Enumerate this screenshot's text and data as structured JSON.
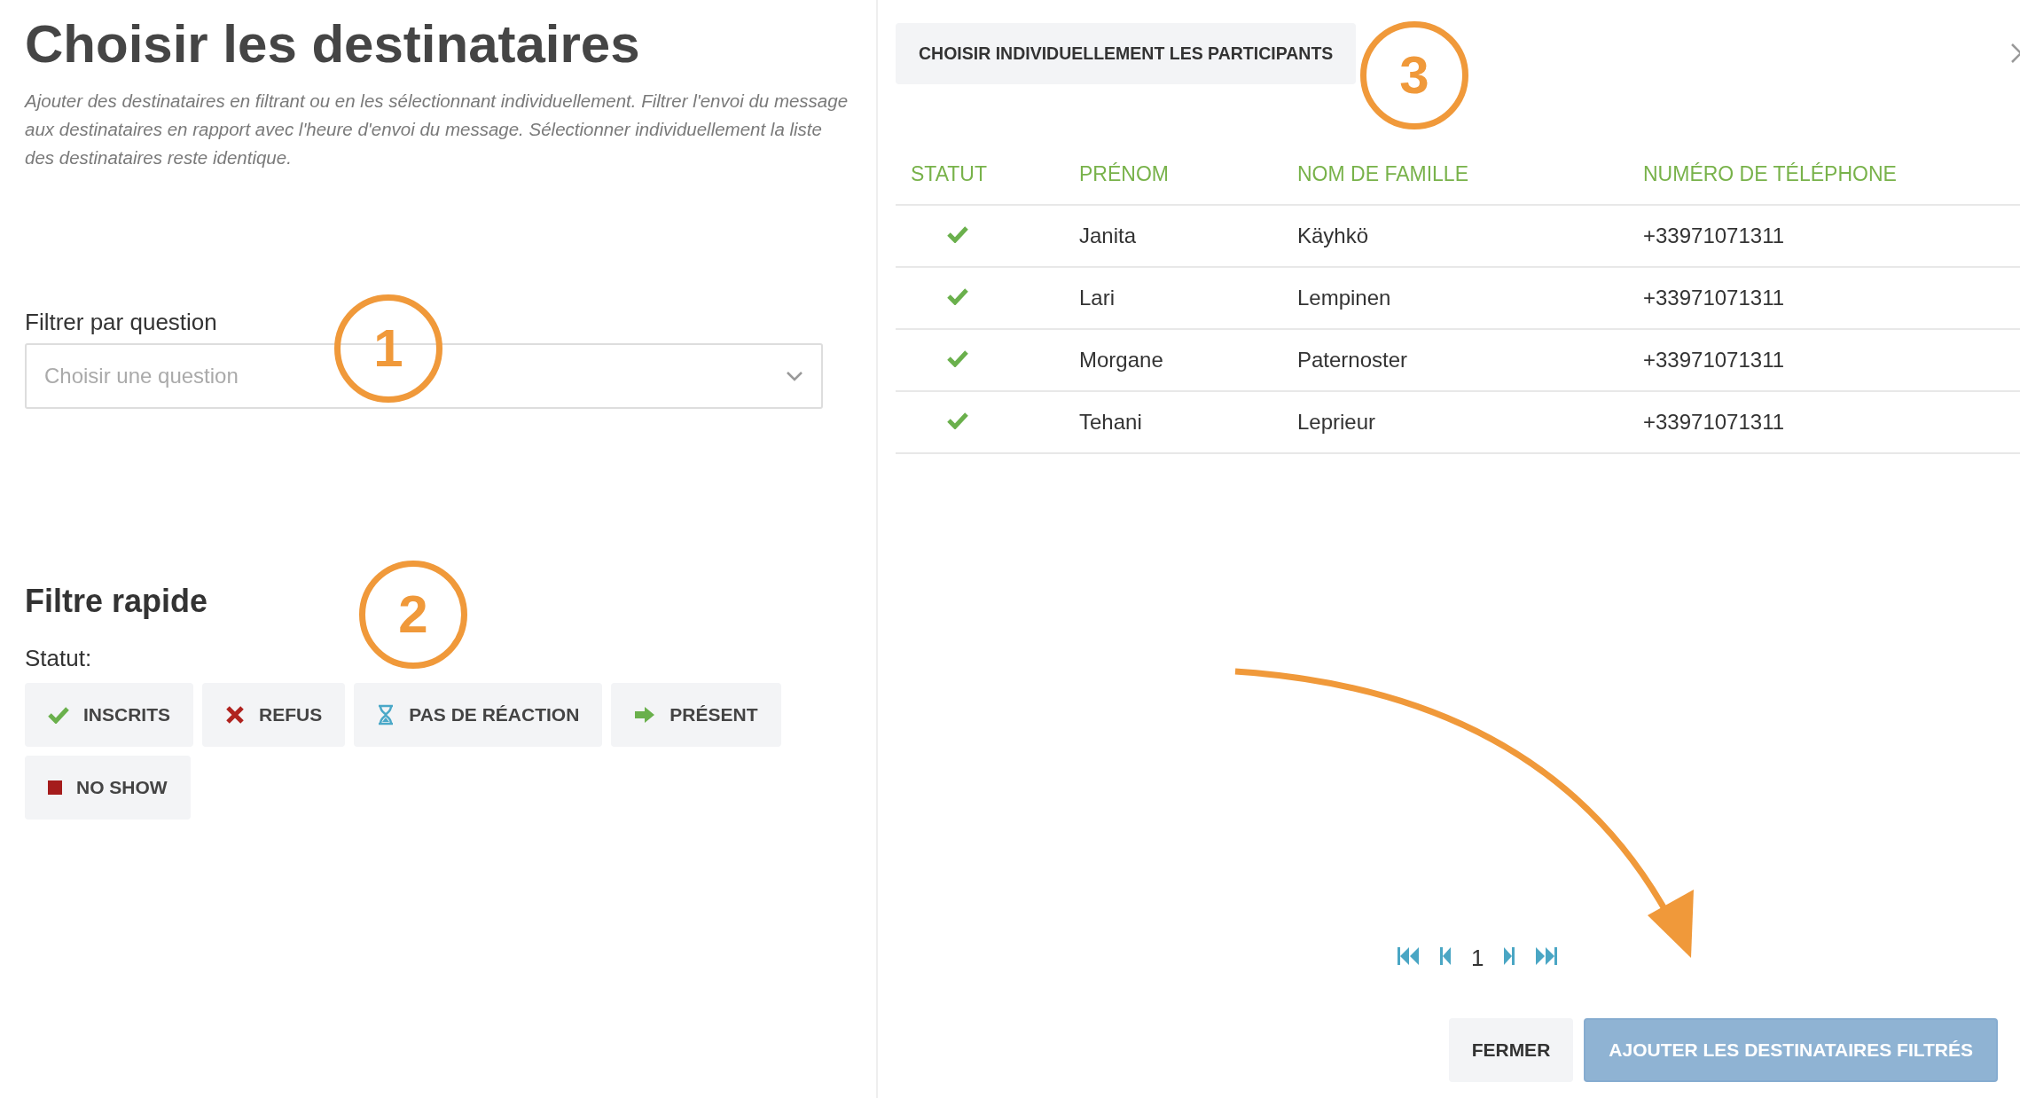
{
  "left": {
    "title": "Choisir les destinataires",
    "description": "Ajouter des destinataires en filtrant ou en les sélectionnant individuellement. Filtrer l'envoi du message aux destinataires en rapport avec l'heure d'envoi du message. Sélectionner individuellement la liste des destinataires reste identique.",
    "question_filter": {
      "label": "Filtrer par question",
      "placeholder": "Choisir une question"
    },
    "quick_filter": {
      "title": "Filtre rapide",
      "status_label": "Statut:",
      "buttons": [
        {
          "label": "INSCRITS",
          "kind": "registered"
        },
        {
          "label": "REFUS",
          "kind": "refused"
        },
        {
          "label": "PAS DE RÉACTION",
          "kind": "pending"
        },
        {
          "label": "PRÉSENT",
          "kind": "present"
        },
        {
          "label": "NO SHOW",
          "kind": "noshow"
        }
      ]
    }
  },
  "right": {
    "pick_button": "CHOISIR INDIVIDUELLEMENT LES PARTICIPANTS",
    "table": {
      "columns": [
        "STATUT",
        "PRÉNOM",
        "NOM DE FAMILLE",
        "NUMÉRO DE TÉLÉPHONE"
      ],
      "rows": [
        {
          "kind": "registered",
          "first_name": "Janita",
          "last_name": "Käyhkö",
          "phone": "+33971071311"
        },
        {
          "kind": "registered",
          "first_name": "Lari",
          "last_name": "Lempinen",
          "phone": "+33971071311"
        },
        {
          "kind": "registered",
          "first_name": "Morgane",
          "last_name": "Paternoster",
          "phone": "+33971071311"
        },
        {
          "kind": "registered",
          "first_name": "Tehani",
          "last_name": "Leprieur",
          "phone": "+33971071311"
        }
      ]
    },
    "pagination": {
      "page": "1"
    },
    "buttons": [
      {
        "label": "FERMER",
        "disabled": false
      },
      {
        "label": "AJOUTER LES DESTINATAIRES FILTRÉS",
        "disabled": true
      }
    ]
  },
  "annotations": [
    {
      "label": "1"
    },
    {
      "label": "2"
    },
    {
      "label": "3"
    }
  ]
}
